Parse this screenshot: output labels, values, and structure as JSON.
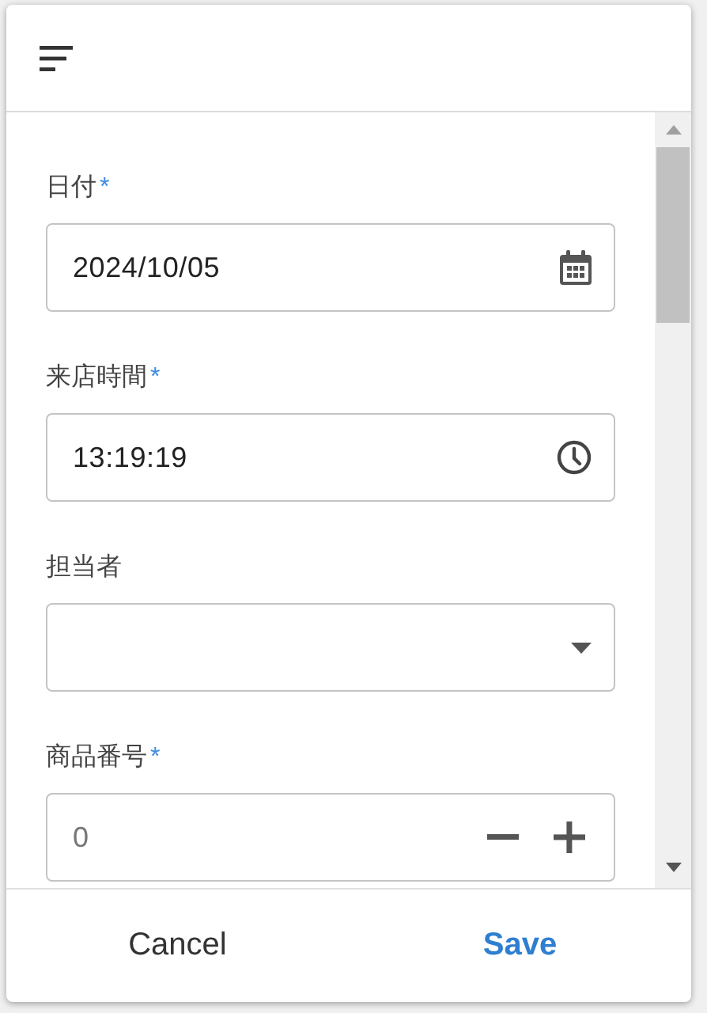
{
  "fields": [
    {
      "kind": "date",
      "label": "日付",
      "required_mark": "*",
      "value": "2024/10/05"
    },
    {
      "kind": "time",
      "label": "来店時間",
      "required_mark": "*",
      "value": "13:19:19"
    },
    {
      "kind": "select",
      "label": "担当者"
    },
    {
      "kind": "number",
      "label": "商品番号",
      "required_mark": "*",
      "placeholder": "0"
    }
  ],
  "buttons": [
    {
      "label": "Cancel",
      "kind": "secondary"
    },
    {
      "label": "Save",
      "kind": "primary"
    }
  ]
}
